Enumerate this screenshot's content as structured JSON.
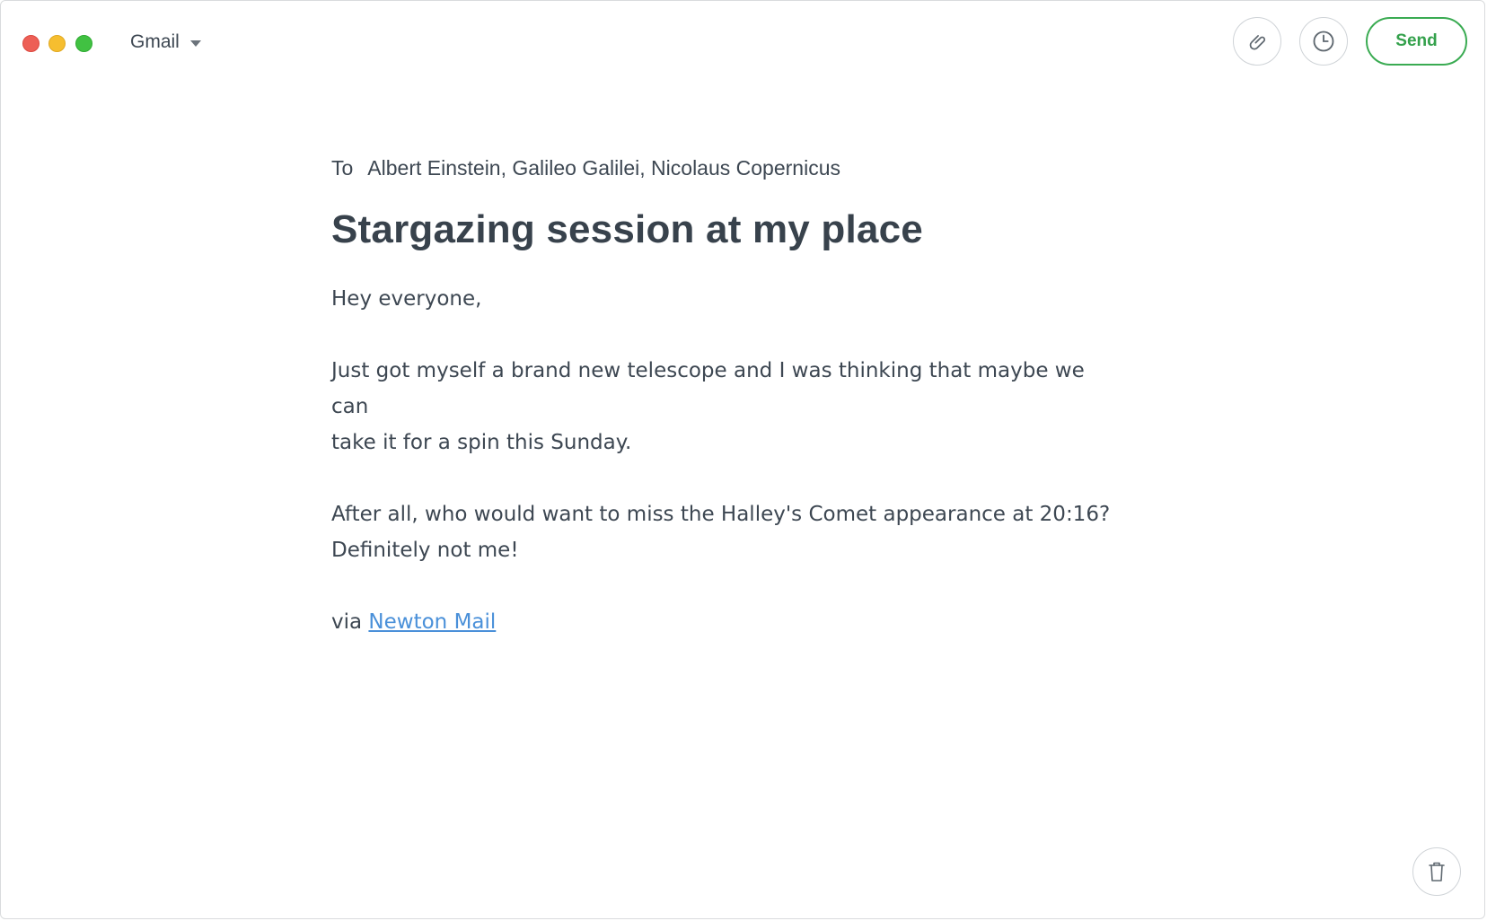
{
  "window": {
    "account_label": "Gmail"
  },
  "toolbar": {
    "send_label": "Send",
    "accent_color": "#3aab52"
  },
  "icons": {
    "attach": "paperclip-icon",
    "schedule": "clock-icon",
    "delete": "trash-icon"
  },
  "compose": {
    "to_label": "To",
    "recipients": "Albert Einstein, Galileo Galilei, Nicolaus Copernicus",
    "subject": "Stargazing session at my place",
    "greeting": "Hey everyone,",
    "paragraph1_line1": "Just got myself a brand new telescope and I was thinking that maybe we can",
    "paragraph1_line2": "take it for a spin this Sunday.",
    "paragraph2_line1": "After all, who would want to miss the Halley's Comet appearance at 20:16?",
    "paragraph2_line2": "Definitely not me!",
    "signature_prefix": "via",
    "signature_link": "Newton Mail"
  }
}
